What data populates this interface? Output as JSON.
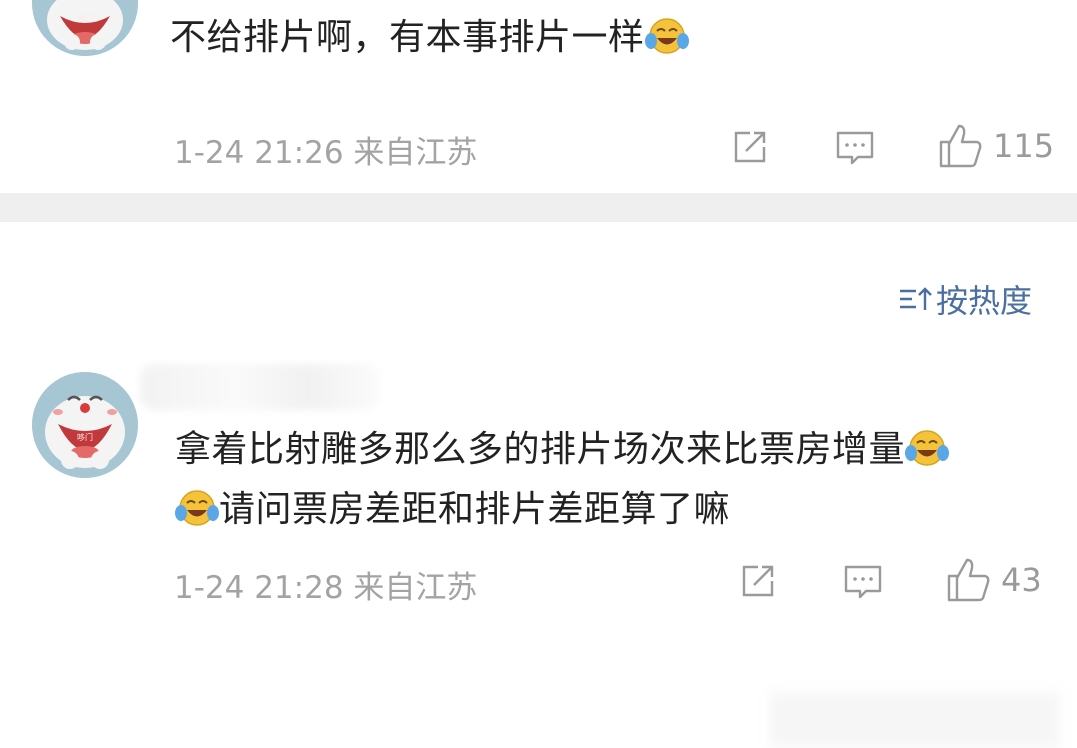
{
  "comments": [
    {
      "avatar_tag": "哆门",
      "text_lines": [
        "不给排片啊，有本事排片一样"
      ],
      "meta": "1-24 21:26 来自江苏",
      "likes": "115"
    },
    {
      "avatar_tag": "哆门",
      "text_lines": [
        "拿着比射雕多那么多的排片场次来比票房增量",
        "请问票房差距和排片差距算了嘛"
      ],
      "meta": "1-24 21:28 来自江苏",
      "likes": "43"
    }
  ],
  "sort": {
    "label": "按热度"
  },
  "icons": {
    "share": "share-icon",
    "comment": "comment-icon",
    "like": "thumbs-up-icon",
    "emoji": "laugh-cry-emoji-icon",
    "sort": "sort-icon"
  },
  "colors": {
    "meta_text": "#a3a3a3",
    "sort_text": "#4a6fa0",
    "divider": "#efefef"
  }
}
